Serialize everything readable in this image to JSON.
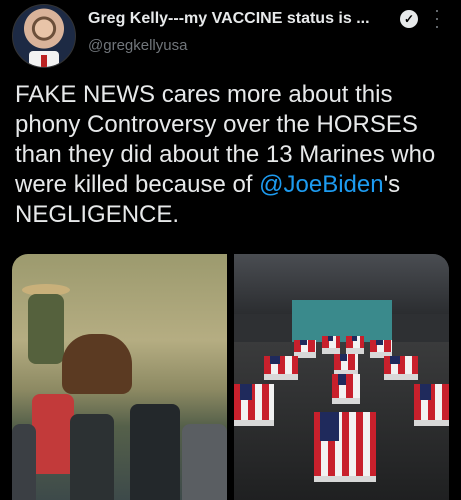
{
  "header": {
    "display_name": "Greg Kelly---my VACCINE status is ...",
    "handle": "@gregkellyusa",
    "verified_icon": "verified-badge-icon",
    "more_icon": "more-vertical-icon"
  },
  "tweet": {
    "text_before": "FAKE NEWS cares more about this phony Controversy over the HORSES than they did about the 13 Marines who were killed because of ",
    "mention": "@JoeBiden",
    "text_after": "'s NEGLIGENCE."
  },
  "colors": {
    "background": "#000000",
    "text": "#e7e9ea",
    "secondary_text": "#71767b",
    "mention": "#1d9bf0"
  }
}
